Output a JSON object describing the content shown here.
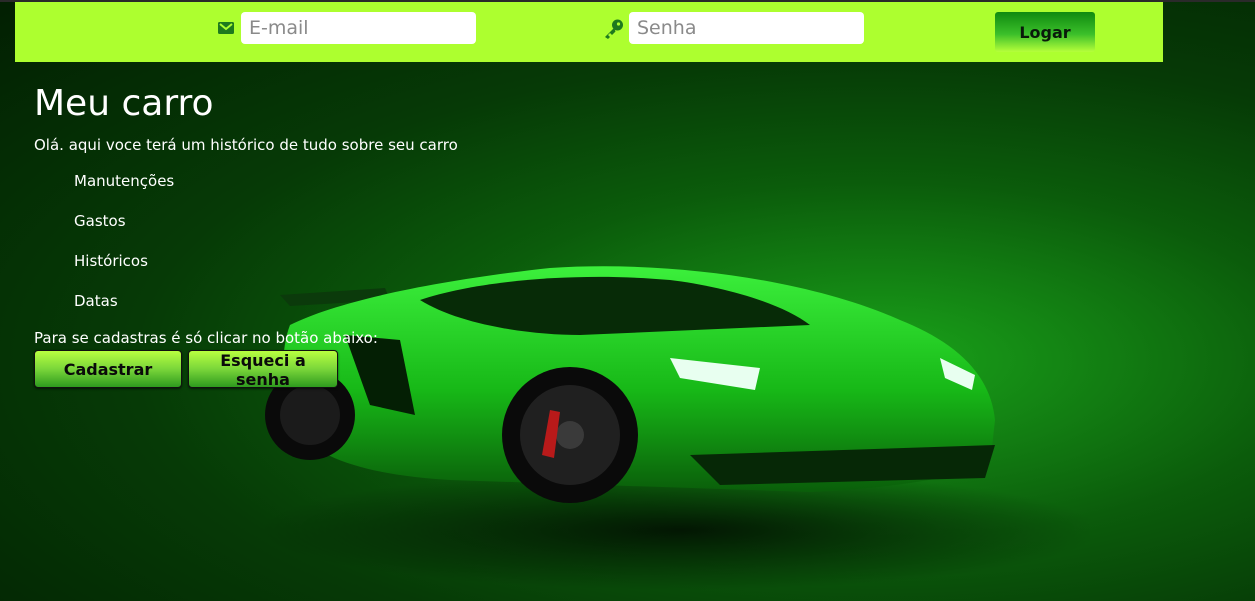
{
  "login": {
    "email_placeholder": "E-mail",
    "password_placeholder": "Senha",
    "submit_label": "Logar"
  },
  "main": {
    "title": "Meu carro",
    "intro": "Olá. aqui voce terá um histórico de tudo sobre seu carro",
    "features": [
      "Manutenções",
      "Gastos",
      "Históricos",
      "Datas"
    ],
    "signup_text": "Para se cadastras é só clicar no botão abaixo:",
    "register_label": "Cadastrar",
    "forgot_label": "Esqueci a senha"
  },
  "colors": {
    "login_bar": "#adff2f",
    "background": "#063a06",
    "car": "#1fd11f"
  },
  "icons": {
    "email": "envelope-icon",
    "password": "key-icon",
    "hero": "car-illustration"
  }
}
